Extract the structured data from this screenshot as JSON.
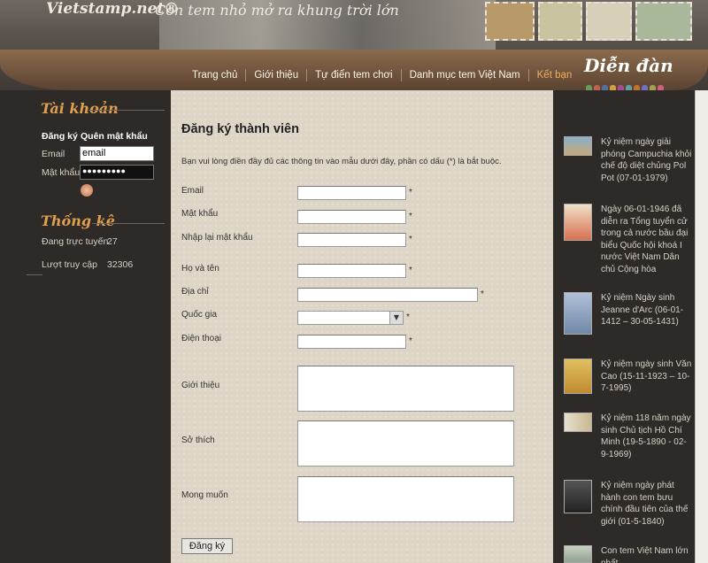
{
  "header": {
    "logo": "Vietstamp.net®",
    "slogan": "Con tem nhỏ mở ra khung trời lớn",
    "nav": [
      "Trang chủ",
      "Giới thiệu",
      "Tự điển tem chơi",
      "Danh mục tem Việt Nam",
      "Kết bạn"
    ],
    "forum": "Diễn đàn"
  },
  "account": {
    "title": "Tài khoản",
    "register": "Đăng ký",
    "forgot": "Quên mật khẩu",
    "email_label": "Email",
    "email_value": "email",
    "password_label": "Mật khẩu",
    "password_value": "●●●●●●●●●"
  },
  "stats": {
    "title": "Thống kê",
    "online_label": "Đang trực tuyến",
    "online_value": "27",
    "visits_label": "Lượt truy cập",
    "visits_value": "32306"
  },
  "form": {
    "title": "Đăng ký thành viên",
    "intro": "Bạn vui lòng điền đầy đủ các thông tin vào mẫu dưới đây, phần có dấu (*) là bắt buộc.",
    "email": "Email",
    "password": "Mật khẩu",
    "password_confirm": "Nhập lại mật khẩu",
    "fullname": "Họ và tên",
    "address": "Địa chỉ",
    "country": "Quốc gia",
    "phone": "Điện thoại",
    "about": "Giới thiệu",
    "hobbies": "Sở thích",
    "wishes": "Mong muốn",
    "required": "*",
    "submit": "Đăng ký"
  },
  "news": [
    {
      "text": "Kỷ niệm ngày giải phóng Campuchia khỏi chế độ diệt chủng Pol Pot (07-01-1979)"
    },
    {
      "text": "Ngày 06-01-1946 đã diễn ra Tổng tuyển cử trong cả nước bầu đại biểu Quốc hội khoá I nước Việt Nam Dân chủ Cộng hòa"
    },
    {
      "text": "Kỷ niệm Ngày sinh Jeanne d'Arc (06-01-1412 – 30-05-1431)"
    },
    {
      "text": "Kỷ niệm ngày sinh Văn Cao (15-11-1923 – 10-7-1995)"
    },
    {
      "text": "Kỷ niệm 118 năm ngày sinh Chủ tịch Hồ Chí Minh (19-5-1890 - 02-9-1969)"
    },
    {
      "text": "Kỷ niệm ngày phát hành con tem bưu chính đầu tiên của thế giới (01-5-1840)"
    },
    {
      "text": "Con tem Việt Nam lớn nhất"
    }
  ],
  "colors": {
    "accent": "#e0a050",
    "nav_active": "#f0b060",
    "sidebar_bg": "#2e2a27",
    "content_bg": "#ddd5c5"
  }
}
